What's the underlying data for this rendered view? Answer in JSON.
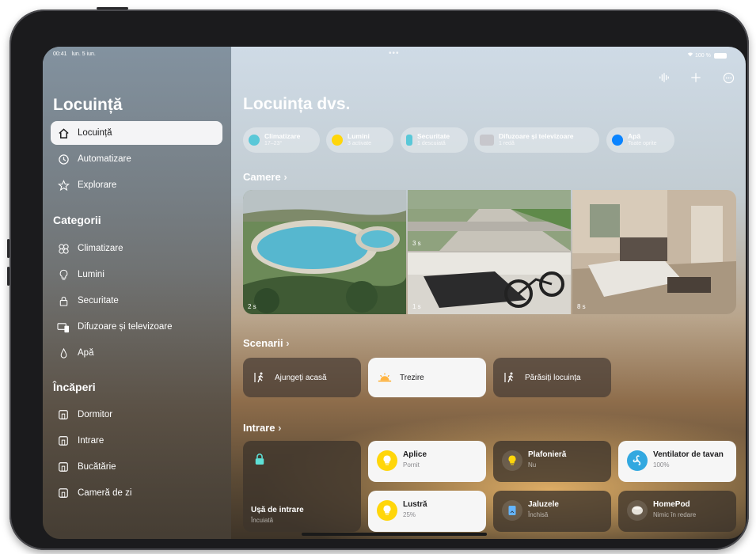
{
  "status_bar": {
    "time": "00:41",
    "date": "lun. 5 iun.",
    "battery": "100 %"
  },
  "sidebar": {
    "title": "Locuință",
    "nav": [
      {
        "label": "Locuință",
        "icon": "house-icon",
        "selected": true
      },
      {
        "label": "Automatizare",
        "icon": "clock-icon"
      },
      {
        "label": "Explorare",
        "icon": "star-icon"
      }
    ],
    "categories_title": "Categorii",
    "categories": [
      {
        "label": "Climatizare",
        "icon": "fan-icon"
      },
      {
        "label": "Lumini",
        "icon": "lightbulb-icon"
      },
      {
        "label": "Securitate",
        "icon": "lock-icon"
      },
      {
        "label": "Difuzoare și televizoare",
        "icon": "tv-speaker-icon"
      },
      {
        "label": "Apă",
        "icon": "water-drop-icon"
      }
    ],
    "rooms_title": "Încăperi",
    "rooms": [
      {
        "label": "Dormitor",
        "icon": "room-icon"
      },
      {
        "label": "Intrare",
        "icon": "room-icon"
      },
      {
        "label": "Bucătărie",
        "icon": "room-icon"
      },
      {
        "label": "Cameră de zi",
        "icon": "room-icon"
      }
    ]
  },
  "main": {
    "title": "Locuința dvs.",
    "toolbar": {
      "voice_icon": "waveform-icon",
      "add_icon": "plus-icon",
      "more_icon": "ellipsis-icon"
    },
    "chips": [
      {
        "title": "Climatizare",
        "subtitle": "17–23°",
        "icon": "fan-icon",
        "color": "#5ac8d8"
      },
      {
        "title": "Lumini",
        "subtitle": "3 activate",
        "icon": "lightbulb-icon",
        "color": "#ffd60a"
      },
      {
        "title": "Securitate",
        "subtitle": "1 descuiată",
        "icon": "lock-icon",
        "color": "#5ac8d8"
      },
      {
        "title": "Difuzoare și televizoare",
        "subtitle": "1 redă",
        "icon": "tv-speaker-icon",
        "color": "#c7c7cc"
      },
      {
        "title": "Apă",
        "subtitle": "Toate oprite",
        "icon": "water-drop-icon",
        "color": "#0a84ff"
      }
    ],
    "cameras_header": "Camere",
    "cameras": [
      {
        "label": "2 s"
      },
      {
        "label": "3 s"
      },
      {
        "label": "1 s"
      },
      {
        "label": "8 s"
      }
    ],
    "scenes_header": "Scenarii",
    "scenes": [
      {
        "label": "Ajungeți acasă",
        "icon": "person-walking-in-icon",
        "active": false
      },
      {
        "label": "Trezire",
        "icon": "sunrise-icon",
        "active": true
      },
      {
        "label": "Părăsiți locuința",
        "icon": "person-walking-out-icon",
        "active": false
      }
    ],
    "room_header": "Intrare",
    "accessories": [
      {
        "title": "Ușă de intrare",
        "subtitle": "Încuiată",
        "icon": "lock-icon",
        "on": false
      },
      {
        "title": "Aplice",
        "subtitle": "Pornit",
        "icon": "lightbulb-icon",
        "on": true
      },
      {
        "title": "Plafonieră",
        "subtitle": "Nu",
        "icon": "lightbulb-icon",
        "on": false
      },
      {
        "title": "Ventilator de tavan",
        "subtitle": "100%",
        "icon": "fan-icon",
        "on": true
      },
      {
        "title": "Lustră",
        "subtitle": "25%",
        "icon": "lightbulb-icon",
        "on": true
      },
      {
        "title": "Jaluzele",
        "subtitle": "Închisă",
        "icon": "blinds-icon",
        "on": false
      },
      {
        "title": "HomePod",
        "subtitle": "Nimic în redare",
        "icon": "homepod-icon",
        "on": false
      }
    ]
  }
}
